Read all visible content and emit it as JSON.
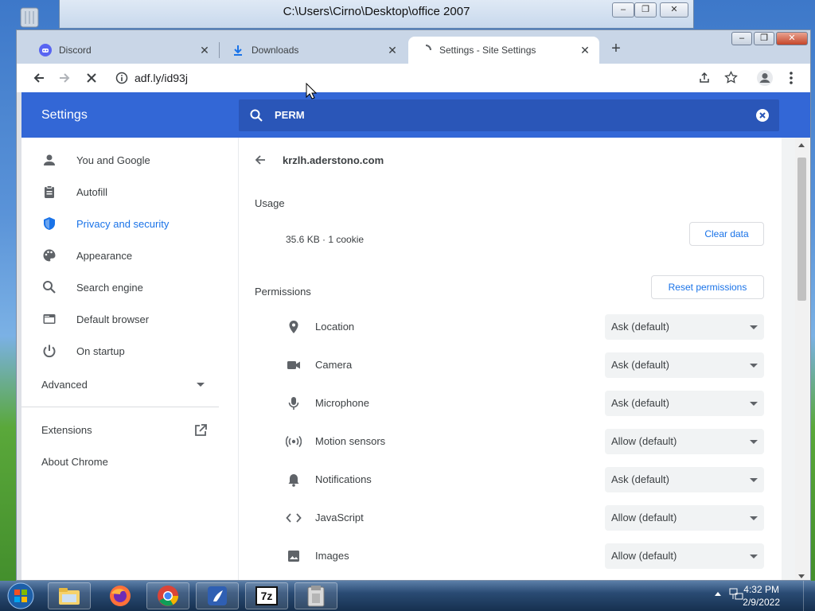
{
  "desktop": {
    "bg_window_title": "C:\\Users\\Cirno\\Desktop\\office 2007",
    "bg_window_controls": [
      "minimize",
      "restore",
      "close"
    ]
  },
  "browser": {
    "tabs": [
      {
        "label": "Discord",
        "icon": "discord-icon",
        "active": false
      },
      {
        "label": "Downloads",
        "icon": "download-icon",
        "active": false
      },
      {
        "label": "Settings - Site Settings",
        "icon": "loading-icon",
        "active": true
      }
    ],
    "new_tab_label": "+",
    "url": "adf.ly/id93j"
  },
  "settings": {
    "header_title": "Settings",
    "search_query": "PERM",
    "nav": [
      {
        "label": "You and Google",
        "icon": "person-icon",
        "active": false
      },
      {
        "label": "Autofill",
        "icon": "clipboard-icon",
        "active": false
      },
      {
        "label": "Privacy and security",
        "icon": "shield-icon",
        "active": true
      },
      {
        "label": "Appearance",
        "icon": "palette-icon",
        "active": false
      },
      {
        "label": "Search engine",
        "icon": "search-icon",
        "active": false
      },
      {
        "label": "Default browser",
        "icon": "browser-icon",
        "active": false
      },
      {
        "label": "On startup",
        "icon": "power-icon",
        "active": false
      }
    ],
    "advanced_label": "Advanced",
    "extensions_label": "Extensions",
    "about_label": "About Chrome",
    "site": "krzlh.aderstono.com",
    "usage_title": "Usage",
    "usage_value": "35.6 KB · 1 cookie",
    "clear_data_label": "Clear data",
    "permissions_title": "Permissions",
    "reset_permissions_label": "Reset permissions",
    "permissions": [
      {
        "label": "Location",
        "icon": "location-icon",
        "value": "Ask (default)"
      },
      {
        "label": "Camera",
        "icon": "camera-icon",
        "value": "Ask (default)"
      },
      {
        "label": "Microphone",
        "icon": "microphone-icon",
        "value": "Ask (default)"
      },
      {
        "label": "Motion sensors",
        "icon": "motion-sensors-icon",
        "value": "Allow (default)"
      },
      {
        "label": "Notifications",
        "icon": "bell-icon",
        "value": "Ask (default)"
      },
      {
        "label": "JavaScript",
        "icon": "code-icon",
        "value": "Allow (default)"
      },
      {
        "label": "Images",
        "icon": "image-icon",
        "value": "Allow (default)"
      }
    ]
  },
  "taskbar": {
    "apps": [
      "file-explorer-icon",
      "firefox-icon",
      "chrome-icon",
      "app-icon",
      "7zip-icon",
      "archive-icon"
    ],
    "seven_zip_label": "7z",
    "time": "4:32 PM",
    "date": "2/9/2022"
  },
  "colors": {
    "accent": "#1a73e8",
    "header_blue": "#3367d6"
  }
}
